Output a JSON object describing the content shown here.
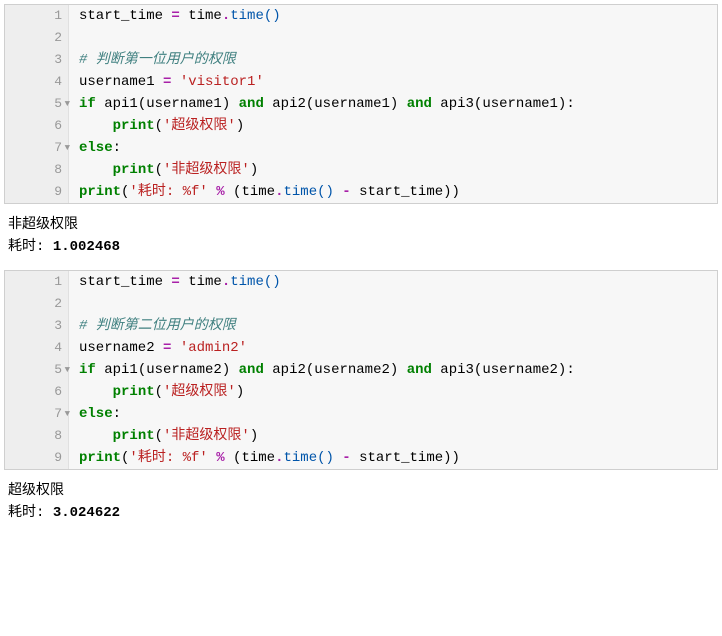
{
  "cell1": {
    "lines": {
      "l1_a": "start_time ",
      "l1_op": "=",
      "l1_b": " time",
      "l1_dot": ".",
      "l1_c": "time()",
      "l3_cmt": "# 判断第一位用户的权限",
      "l4_a": "username1 ",
      "l4_op": "=",
      "l4_sp": " ",
      "l4_str": "'visitor1'",
      "l5_if": "if",
      "l5_a": " api1(username1) ",
      "l5_and1": "and",
      "l5_b": " api2(username1) ",
      "l5_and2": "and",
      "l5_c": " api3(username1):",
      "l6_indent": "    ",
      "l6_print": "print",
      "l6_p1": "(",
      "l6_str": "'超级权限'",
      "l6_p2": ")",
      "l7_else": "else",
      "l7_colon": ":",
      "l8_indent": "    ",
      "l8_print": "print",
      "l8_p1": "(",
      "l8_str": "'非超级权限'",
      "l8_p2": ")",
      "l9_print": "print",
      "l9_p1": "(",
      "l9_str": "'耗时: %f'",
      "l9_sp1": " ",
      "l9_op": "%",
      "l9_sp2": " (time",
      "l9_dot": ".",
      "l9_time": "time() ",
      "l9_minus": "-",
      "l9_end": " start_time))"
    },
    "output": {
      "line1": "非超级权限",
      "line2a": "耗时: ",
      "line2b": "1.002468"
    }
  },
  "cell2": {
    "lines": {
      "l1_a": "start_time ",
      "l1_op": "=",
      "l1_b": " time",
      "l1_dot": ".",
      "l1_c": "time()",
      "l3_cmt": "# 判断第二位用户的权限",
      "l4_a": "username2 ",
      "l4_op": "=",
      "l4_sp": " ",
      "l4_str": "'admin2'",
      "l5_if": "if",
      "l5_a": " api1(username2) ",
      "l5_and1": "and",
      "l5_b": " api2(username2) ",
      "l5_and2": "and",
      "l5_c": " api3(username2):",
      "l6_indent": "    ",
      "l6_print": "print",
      "l6_p1": "(",
      "l6_str": "'超级权限'",
      "l6_p2": ")",
      "l7_else": "else",
      "l7_colon": ":",
      "l8_indent": "    ",
      "l8_print": "print",
      "l8_p1": "(",
      "l8_str": "'非超级权限'",
      "l8_p2": ")",
      "l9_print": "print",
      "l9_p1": "(",
      "l9_str": "'耗时: %f'",
      "l9_sp1": " ",
      "l9_op": "%",
      "l9_sp2": " (time",
      "l9_dot": ".",
      "l9_time": "time() ",
      "l9_minus": "-",
      "l9_end": " start_time))"
    },
    "output": {
      "line1": "超级权限",
      "line2a": "耗时: ",
      "line2b": "3.024622"
    }
  },
  "lineNumbers": [
    "1",
    "2",
    "3",
    "4",
    "5",
    "6",
    "7",
    "8",
    "9"
  ]
}
